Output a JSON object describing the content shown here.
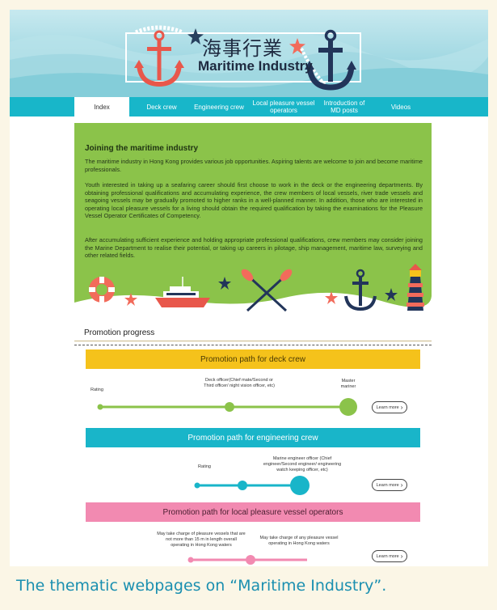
{
  "header": {
    "title_cn": "海事行業",
    "title_en": "Maritime Industry"
  },
  "nav": {
    "items": [
      {
        "label": "Index",
        "active": true
      },
      {
        "label": "Deck crew",
        "active": false
      },
      {
        "label": "Engineering crew",
        "active": false
      },
      {
        "label": "Local pleasure vessel operators",
        "active": false
      },
      {
        "label": "Introduction of MD posts",
        "active": false
      },
      {
        "label": "Videos",
        "active": false
      }
    ]
  },
  "intro": {
    "heading": "Joining the maritime industry",
    "paragraphs": [
      "The maritime industry in Hong Kong provides various job opportunities. Aspiring talents are welcome to join and become maritime professionals.",
      "Youth interested in taking up a seafaring career should first choose to work in the deck or the engineering departments. By obtaining professional qualifications and accumulating experience, the crew members of local vessels, river trade vessels and seagoing vessels may be gradually promoted to higher ranks in a well-planned manner. In addition, those who are interested in operating local pleasure vessels for a living should obtain the required qualification by taking the examinations for the Pleasure Vessel Operator Certificates of Competency.",
      "After accumulating sufficient experience and holding appropriate professional qualifications, crew members may consider joining the Marine Department to realise their potential, or taking up careers in pilotage, ship management, maritime law, surveying and other related fields."
    ]
  },
  "promotion": {
    "heading": "Promotion progress",
    "learn_more": "Learn more",
    "deck": {
      "title": "Promotion path for deck crew",
      "stages": [
        "Rating",
        "Deck officer(Chief mate/Second or Third officer/ night vision officer, etc)",
        "Master mariner"
      ]
    },
    "engineering": {
      "title": "Promotion path for engineering crew",
      "stages": [
        "Rating",
        "Marine engineer officer (Chief engineer/Second engineer/ engineering watch keeping officer, etc)"
      ]
    },
    "local": {
      "title": "Promotion path for local pleasure vessel operators",
      "stages": [
        "May take charge of pleasure vessels that are not more than 15 m in length overall operating in Hong Kong waters",
        "May take charge of any pleasure vessel operating in Hong Kong waters"
      ]
    }
  },
  "caption": "The thematic webpages on “Maritime Industry”.",
  "colors": {
    "nav": "#18b6c9",
    "intro_bg": "#8bc34a",
    "deck": "#f5c21b",
    "engineering": "#19b5c9",
    "local": "#f28ab1",
    "caption": "#1a8fb0"
  }
}
